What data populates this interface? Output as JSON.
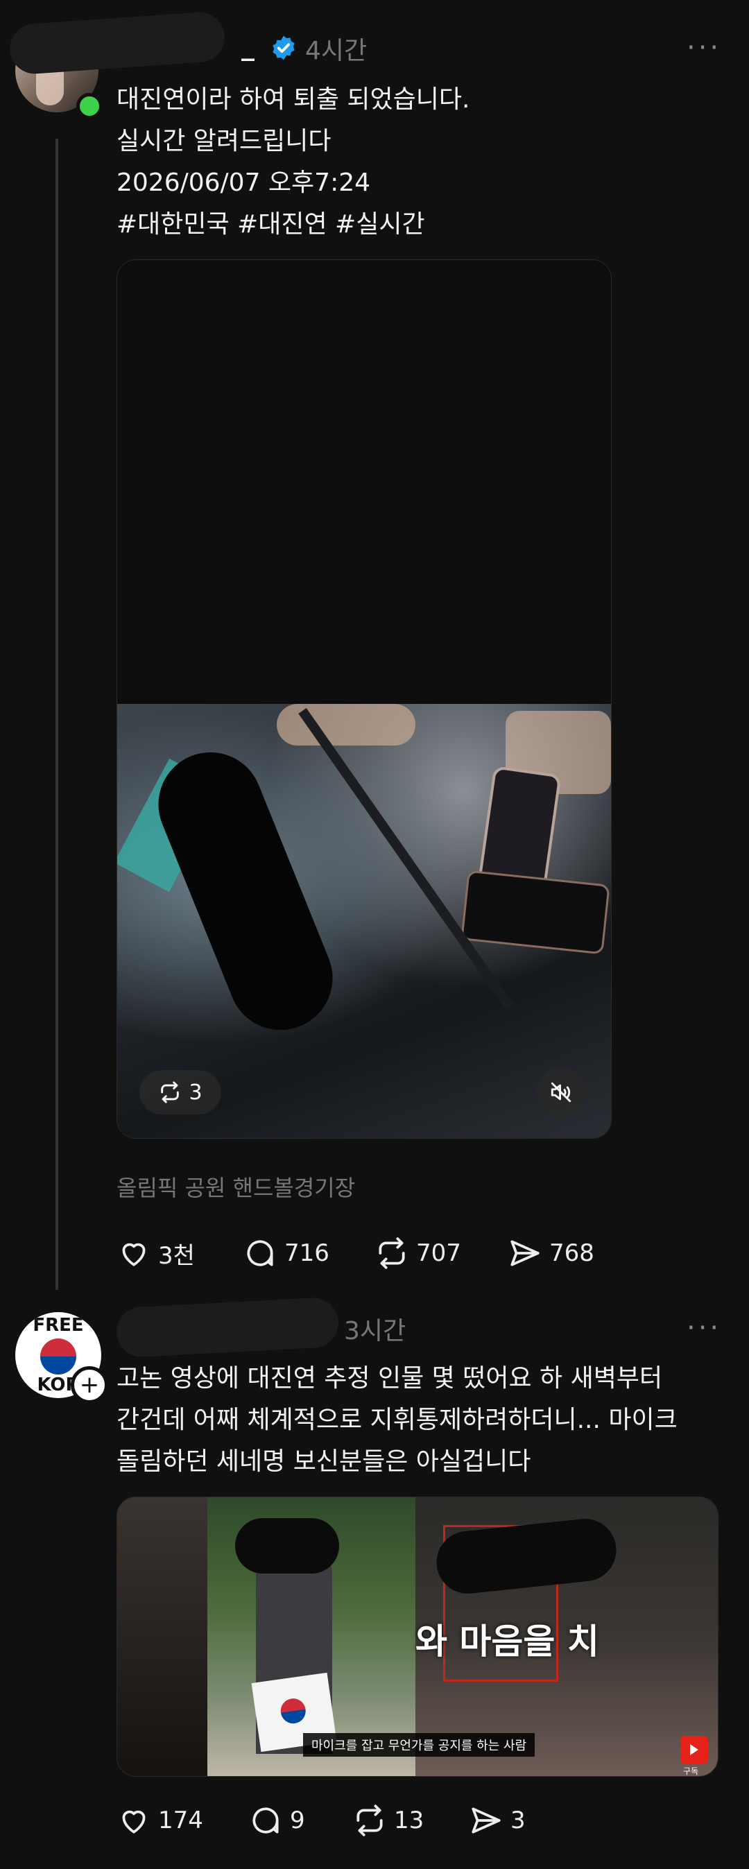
{
  "post1": {
    "username": "_",
    "time": "4시간",
    "more": "···",
    "lines": [
      "대진연이라 하여 퇴출 되었습니다.",
      "실시간 알려드립니다",
      "2026/06/07 오후7:24",
      "#대한민국 #대진연 #실시간"
    ],
    "repost_badge": "3",
    "location": "올림픽 공원 핸드볼경기장",
    "actions": {
      "likes": "3천",
      "replies": "716",
      "reposts": "707",
      "shares": "768"
    }
  },
  "post2": {
    "avatar_text_top": "FREE",
    "avatar_text_bottom": "KOR",
    "time": "3시간",
    "more": "···",
    "lines": [
      "고논 영상에 대진연 추정 인물 몇 떴어요 하 새벽부터",
      "간건데 어째 체계적으로 지휘통제하려하더니... 마이크",
      "돌림하던 세네명 보신분들은 아실겁니다"
    ],
    "video_overlay": "와 마음을 치",
    "video_caption": "마이크를 잡고 무언가를 공지를 하는 사람",
    "yt_label": "구독",
    "actions": {
      "likes": "174",
      "replies": "9",
      "reposts": "13",
      "shares": "3"
    }
  },
  "colors": {
    "background": "#101010",
    "verified": "#1d9bf0",
    "online": "#3ed14a"
  }
}
